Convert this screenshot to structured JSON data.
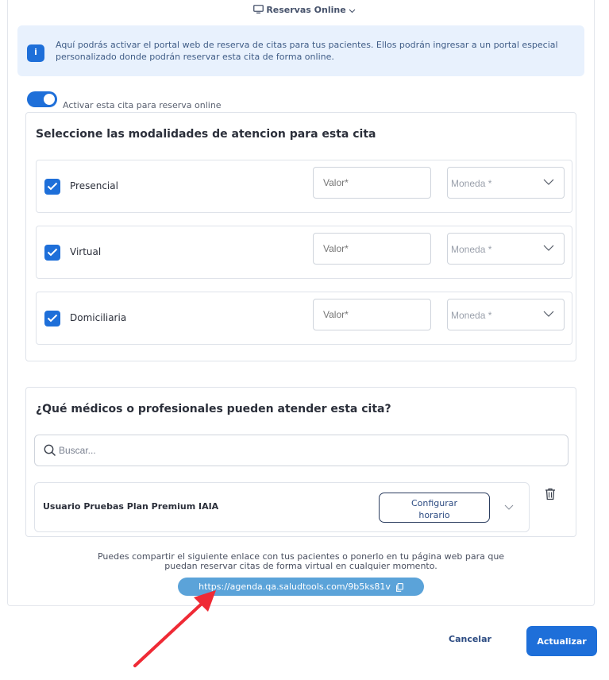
{
  "section": {
    "title": "Reservas Online"
  },
  "info": {
    "text": "Aquí podrás activar el portal web de reserva de citas para tus pacientes. Ellos podrán ingresar a un portal especial personalizado donde podrán reservar esta cita de forma online."
  },
  "toggle": {
    "label": "Activar esta cita para reserva online",
    "on": true
  },
  "modalities": {
    "title": "Seleccione las modalidades de atencion para esta cita",
    "valor_placeholder": "Valor*",
    "moneda_placeholder": "Moneda *",
    "items": [
      {
        "label": "Presencial",
        "checked": true
      },
      {
        "label": "Virtual",
        "checked": true
      },
      {
        "label": "Domiciliaria",
        "checked": true
      }
    ]
  },
  "doctors": {
    "title": "¿Qué médicos o profesionales pueden atender esta cita?",
    "search_placeholder": "Buscar...",
    "list": [
      {
        "name": "Usuario Pruebas Plan Premium IAIA",
        "button_line1": "Configurar",
        "button_line2": "horario"
      }
    ]
  },
  "share": {
    "text_line1": "Puedes compartir el siguiente enlace con tus pacientes o ponerlo en tu página web para que",
    "text_line2": "puedan reservar citas de forma virtual en cualquier momento.",
    "link": "https://agenda.qa.saludtools.com/9b5ks81v"
  },
  "actions": {
    "cancel": "Cancelar",
    "update": "Actualizar"
  },
  "colors": {
    "primary": "#1e6fd9",
    "link_pill": "#5ba3d9",
    "arrow": "#ef2a35",
    "info_bg": "#e8f1fd"
  }
}
